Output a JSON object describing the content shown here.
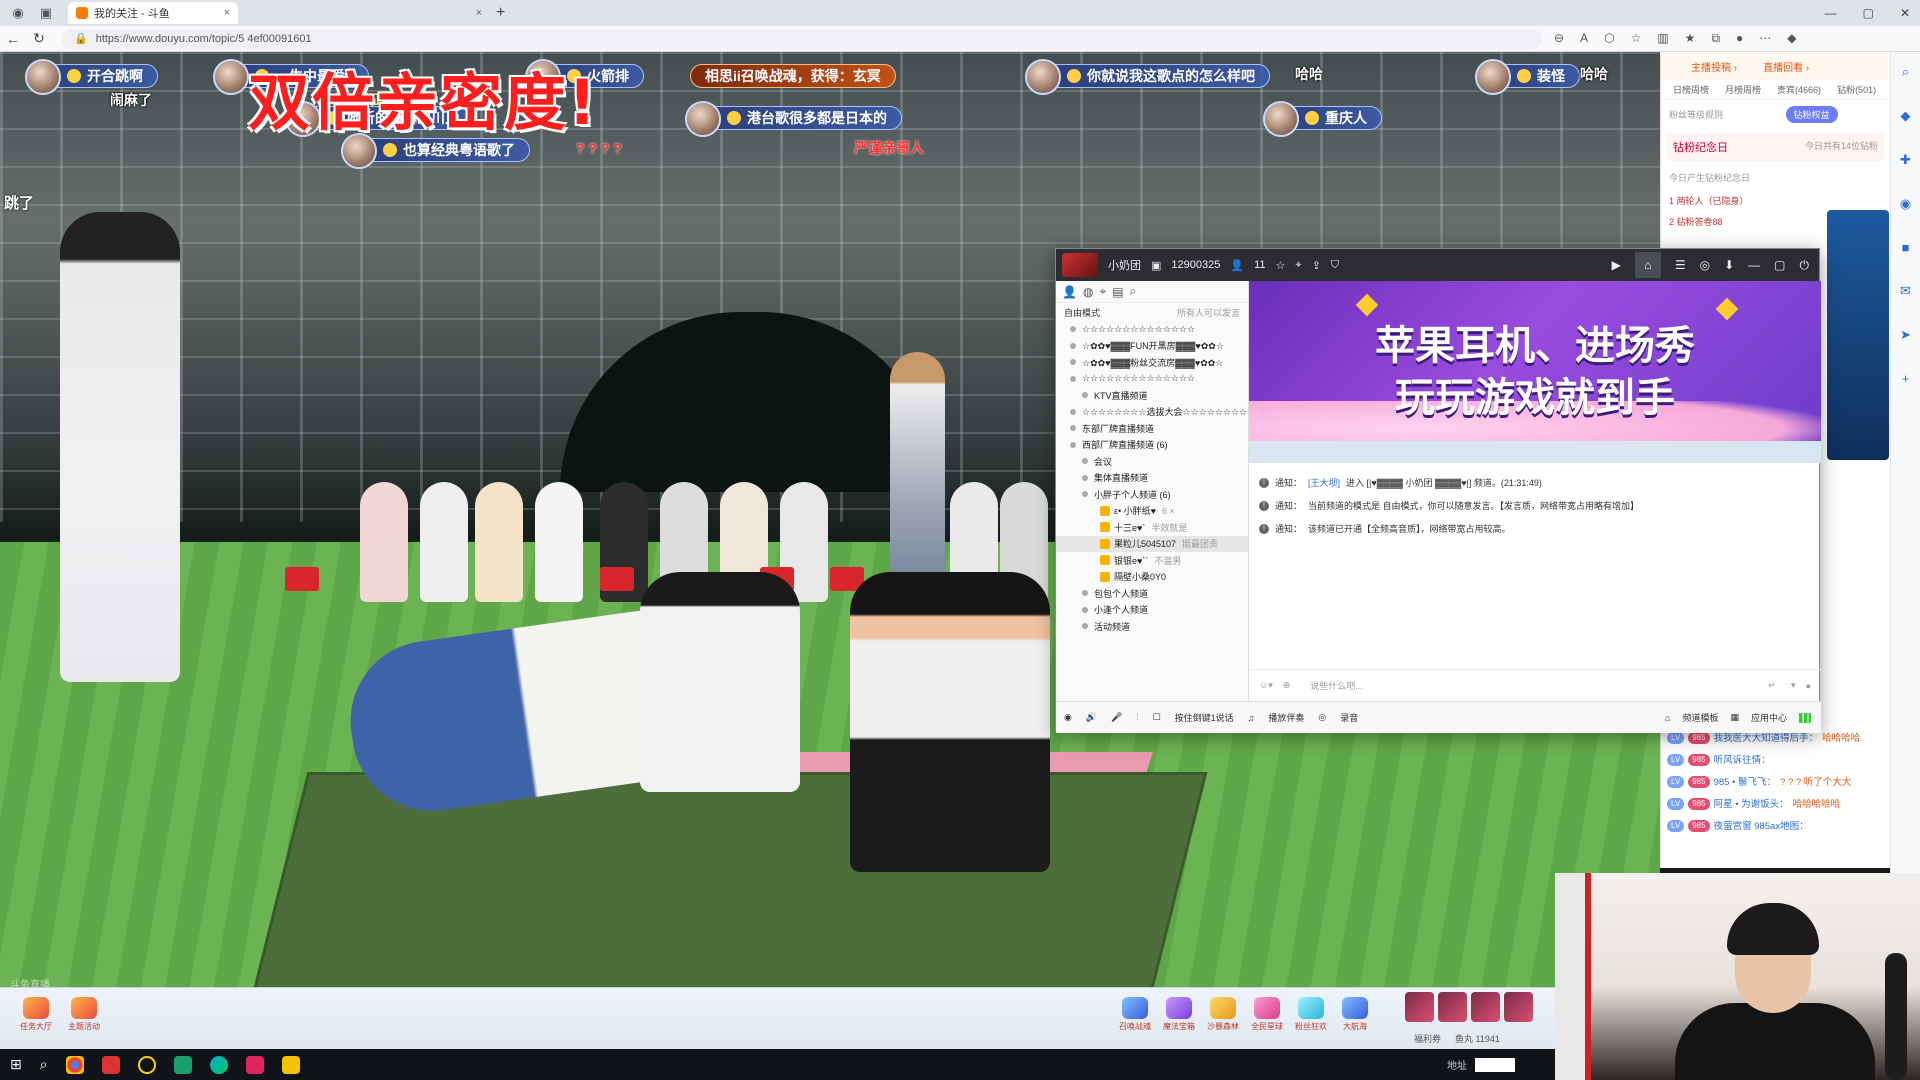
{
  "browser": {
    "tab_active": "我的关注 - 斗鱼",
    "tab_close": "×",
    "url": "https://www.douyu.com/topic/5   4ef00091601",
    "new_tab": "+"
  },
  "overlay": {
    "big_title": "双倍亲密度!",
    "edge_text": "跳了",
    "corner_mark": "斗鱼直播"
  },
  "danmaku": [
    {
      "text": "开合跳啊",
      "style": "badge"
    },
    {
      "text": "一生中最爱?",
      "style": "badge"
    },
    {
      "text": "火箭排",
      "style": "badge"
    },
    {
      "text": "相思ii召唤战魂，获得：玄冥",
      "style": "orange-pill"
    },
    {
      "text": "你就说我这歌点的怎么样吧",
      "style": "badge"
    },
    {
      "text": "哈哈",
      "style": "plain"
    },
    {
      "text": "装怪",
      "style": "badge"
    },
    {
      "text": "哈哈",
      "style": "plain"
    },
    {
      "text": "闹麻了",
      "style": "plain"
    },
    {
      "text": "年龄大耳聋 理解",
      "style": "yellow"
    },
    {
      "text": "她听的懂嘛四川人",
      "style": "badge"
    },
    {
      "text": "港台歌很多都是日本的",
      "style": "badge"
    },
    {
      "text": "重庆人",
      "style": "badge"
    },
    {
      "text": "也算经典粤语歌了",
      "style": "badge"
    },
    {
      "text": "? ? ? ?",
      "style": "red"
    },
    {
      "text": "严谨亲哥人",
      "style": "red"
    }
  ],
  "giftbar": {
    "left": [
      "任务大厅",
      "主题活动"
    ],
    "right": [
      "召唤战魂",
      "魔法宝箱",
      "沙暴森林",
      "全民星球",
      "粉丝狂欢",
      "大航海"
    ],
    "status": [
      "福利券",
      "鱼丸 11941"
    ]
  },
  "right_panel": {
    "top_links": [
      "主播投稿 ›",
      "直播回看 ›"
    ],
    "tabs": [
      "日榜周榜",
      "月榜周榜",
      "贵宾(4666)",
      "钻粉(501)"
    ],
    "fan_rule": "粉丝等级规则",
    "badge": "钻粉权益",
    "anniversary_title": "钻粉纪念日",
    "anniversary_note": "今日共有14位钻粉",
    "anniversary_sub": "今日产生钻粉纪念日",
    "rank1": "两轮人（已隐身）",
    "rank2": "钻粉答卷88",
    "chat": [
      {
        "level": "LV",
        "fan": "985",
        "user": "我我医大大知道得后手：",
        "msg": "哈哈哈哈"
      },
      {
        "level": "LV",
        "fan": "985",
        "user": "听风诉往情：",
        "msg": ""
      },
      {
        "level": "LV",
        "fan": "985",
        "user": "985 • 鬃飞飞：",
        "msg": "? ? ? 听了个大大"
      },
      {
        "level": "LV",
        "fan": "985",
        "user": "阿星 • 为谢饭头：",
        "msg": "哈哈哈哈哈"
      },
      {
        "level": "LV",
        "fan": "985",
        "user": "夜萤宫窗 985ax地图：",
        "msg": ""
      }
    ]
  },
  "app": {
    "title": "小奶团",
    "room_id": "12900325",
    "online": "11",
    "mode": "自由模式",
    "mode_hint": "所有人可以发言",
    "channels": [
      {
        "label": "☆☆☆☆☆☆☆☆☆☆☆☆☆☆",
        "level": 1
      },
      {
        "label": "☆✿✿♥▓▓▓FUN开黑房▓▓▓♥✿✿☆",
        "level": 1
      },
      {
        "label": "☆✿✿♥▓▓▓粉丝交流房▓▓▓♥✿✿☆",
        "level": 1
      },
      {
        "label": "☆☆☆☆☆☆☆☆☆☆☆☆☆☆",
        "level": 1
      },
      {
        "label": "KTV直播频道",
        "level": 2
      },
      {
        "label": "☆☆☆☆☆☆☆☆选拔大会☆☆☆☆☆☆☆☆",
        "level": 1
      },
      {
        "label": "东部厂牌直播频道",
        "level": 1
      },
      {
        "label": "西部厂牌直播频道 (6)",
        "level": 1
      },
      {
        "label": "会议",
        "level": 2
      },
      {
        "label": "集体直播频道",
        "level": 2
      },
      {
        "label": "小胖子个人频道 (6)",
        "level": 2
      }
    ],
    "users": [
      {
        "name": "ε• 小胖纸♥",
        "tag": "6 ×"
      },
      {
        "name": "十三e♥`",
        "tag": "半效就是"
      },
      {
        "name": "果粒儿5045107",
        "tag": "挺最团贡"
      },
      {
        "name": "银银e♥``",
        "tag": "不滥男"
      },
      {
        "name": "隔壁小桑0Y0",
        "tag": ""
      }
    ],
    "channels_after": [
      "包包个人频道",
      "小逢个人频道",
      "活动频道"
    ],
    "banner_line1": "苹果耳机、进场秀",
    "banner_line2": "玩玩游戏就到手",
    "notices": [
      {
        "prefix": "通知：",
        "highlight": "[王大坝]",
        "text": "进入 [|♥▓▓▓▓ 小奶团 ▓▓▓▓♥|] 频道。(21:31:49)"
      },
      {
        "prefix": "通知：",
        "highlight": "",
        "text": "当前频道的模式是 自由模式，你可以随意发言。【发言质，网络带宽占用略有增加】"
      },
      {
        "prefix": "通知：",
        "highlight": "",
        "text": "该频道已开通【全频高音质】，网络带宽占用较高。"
      }
    ],
    "input_placeholder": "说些什么吧...",
    "footer": {
      "hold_to_talk": "按住倒键1说话",
      "accompany": "播放伴奏",
      "record": "录音",
      "template": "频道模板",
      "app_center": "应用中心"
    }
  },
  "taskbar": {
    "addr_label": "地址"
  }
}
